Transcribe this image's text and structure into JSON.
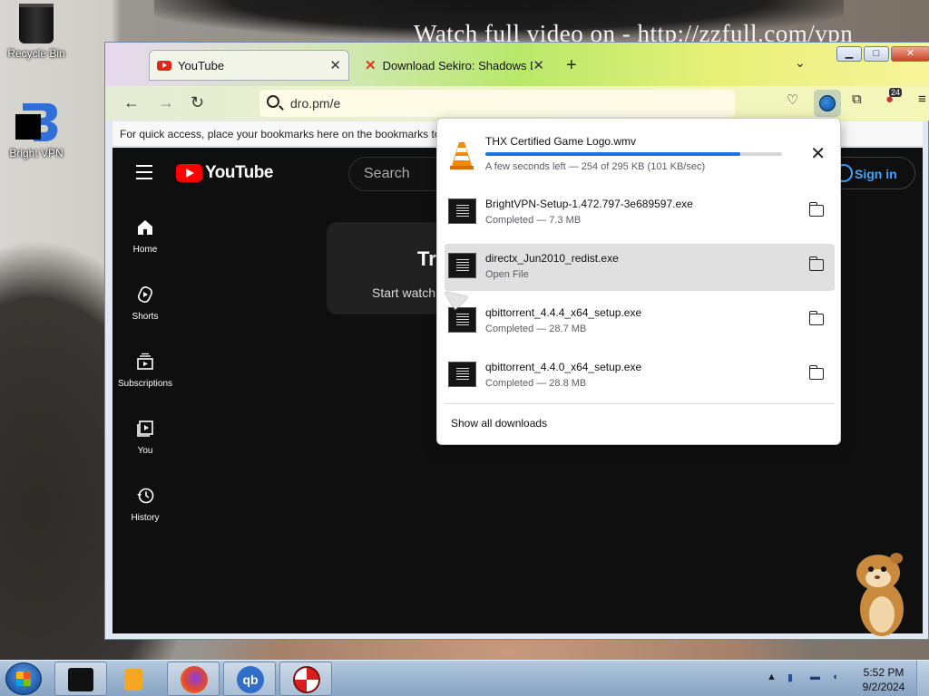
{
  "desktop": {
    "watermark": "Watch full video on - http://zzfull.com/vpn",
    "icons": [
      {
        "label": "Recycle Bin"
      },
      {
        "label": "Bright VPN"
      }
    ]
  },
  "browser": {
    "tabs": [
      {
        "label": "YouTube"
      },
      {
        "label": "Download Sekiro: Shadows Die"
      }
    ],
    "url": "dro.pm/e",
    "extension_badge": "24",
    "bookmarks_hint": "For quick access, place your bookmarks here on the bookmarks to"
  },
  "youtube": {
    "wordmark": "YouTube",
    "search_placeholder": "Search",
    "sign_in": "Sign in",
    "nav": [
      {
        "label": "Home"
      },
      {
        "label": "Shorts"
      },
      {
        "label": "Subscriptions"
      },
      {
        "label": "You"
      },
      {
        "label": "History"
      }
    ],
    "promo_title": "Tr",
    "promo_sub": "Start watch"
  },
  "downloads": {
    "active": {
      "name": "THX Certified Game Logo.wmv",
      "status": "A few seconds left — 254 of 295 KB (101 KB/sec)",
      "progress": 0.86
    },
    "items": [
      {
        "name": "BrightVPN-Setup-1.472.797-3e689597.exe",
        "status": "Completed — 7.3 MB"
      },
      {
        "name": "directx_Jun2010_redist.exe",
        "status": "Open File"
      },
      {
        "name": "qbittorrent_4.4.4_x64_setup.exe",
        "status": "Completed — 28.7 MB"
      },
      {
        "name": "qbittorrent_4.4.0_x64_setup.exe",
        "status": "Completed — 28.8 MB"
      }
    ],
    "show_all": "Show all downloads"
  },
  "taskbar": {
    "time": "5:52 PM",
    "date": "9/2/2024"
  },
  "colors": {
    "youtube_red": "#ff0000",
    "progress_blue": "#1a73e8",
    "signin_blue": "#3ea6ff"
  }
}
